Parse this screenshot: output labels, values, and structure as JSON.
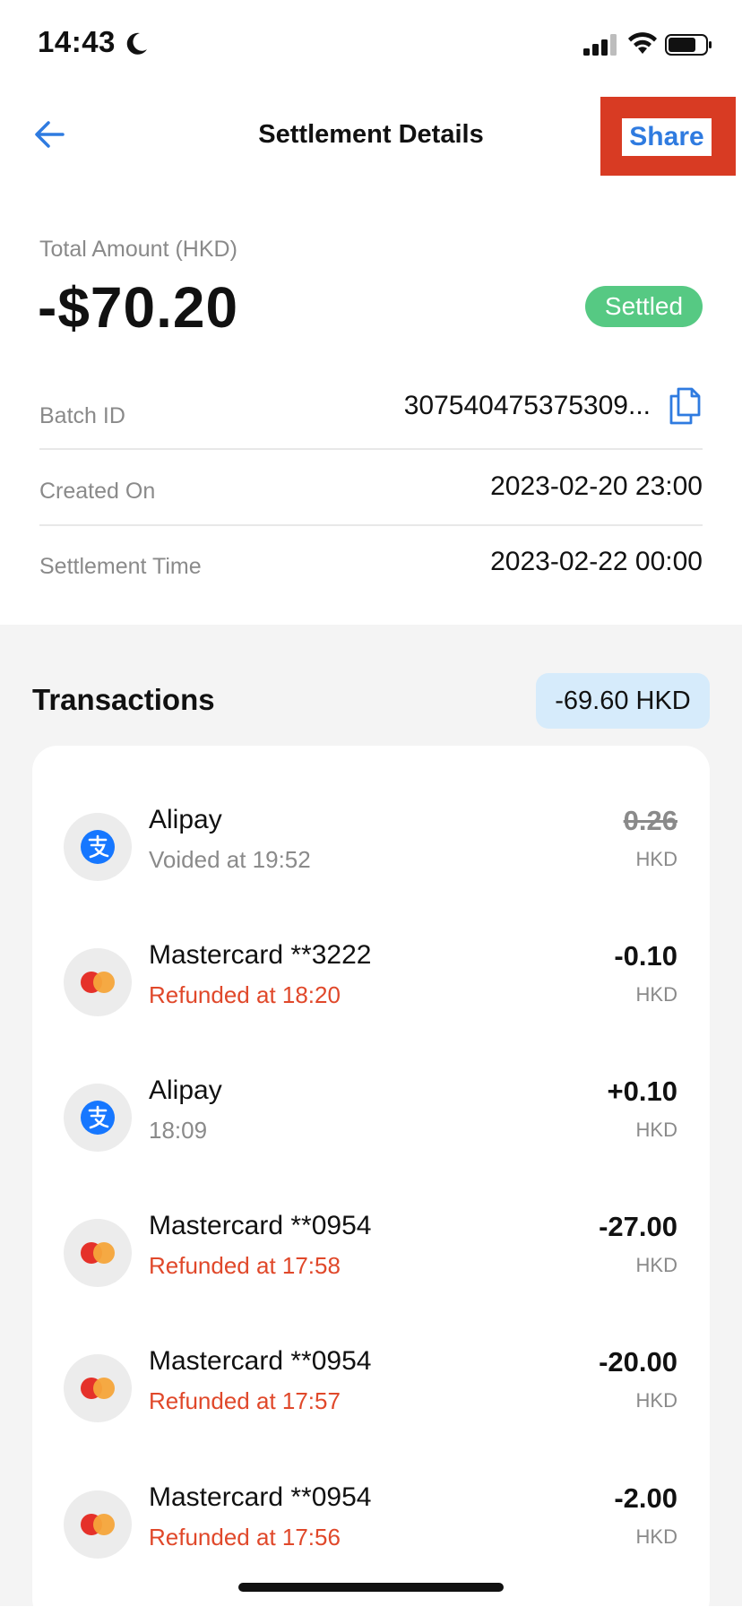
{
  "status_bar": {
    "time": "14:43"
  },
  "nav": {
    "title": "Settlement Details",
    "share_label": "Share"
  },
  "summary": {
    "total_label": "Total Amount (HKD)",
    "total_amount": "-$70.20",
    "status": "Settled",
    "batch_id_label": "Batch ID",
    "batch_id": "307540475375309...",
    "created_on_label": "Created On",
    "created_on": "2023-02-20 23:00",
    "settlement_time_label": "Settlement Time",
    "settlement_time": "2023-02-22 00:00"
  },
  "transactions": {
    "title": "Transactions",
    "total": "-69.60 HKD",
    "items": [
      {
        "icon": "alipay-icon",
        "name": "Alipay",
        "sub": "Voided at 19:52",
        "amount": "0.26",
        "currency": "HKD",
        "state": "voided"
      },
      {
        "icon": "mastercard-icon",
        "name": "Mastercard **3222",
        "sub": "Refunded at 18:20",
        "amount": "-0.10",
        "currency": "HKD",
        "state": "refunded"
      },
      {
        "icon": "alipay-icon",
        "name": "Alipay",
        "sub": "18:09",
        "amount": "+0.10",
        "currency": "HKD",
        "state": "normal"
      },
      {
        "icon": "mastercard-icon",
        "name": "Mastercard **0954",
        "sub": "Refunded at 17:58",
        "amount": "-27.00",
        "currency": "HKD",
        "state": "refunded"
      },
      {
        "icon": "mastercard-icon",
        "name": "Mastercard **0954",
        "sub": "Refunded at 17:57",
        "amount": "-20.00",
        "currency": "HKD",
        "state": "refunded"
      },
      {
        "icon": "mastercard-icon",
        "name": "Mastercard **0954",
        "sub": "Refunded at 17:56",
        "amount": "-2.00",
        "currency": "HKD",
        "state": "refunded"
      }
    ]
  },
  "colors": {
    "accent": "#2f7be0",
    "settled": "#56c983",
    "refund": "#e0482a",
    "share_highlight": "#d83b23",
    "total_badge_bg": "#d6ebfb"
  }
}
